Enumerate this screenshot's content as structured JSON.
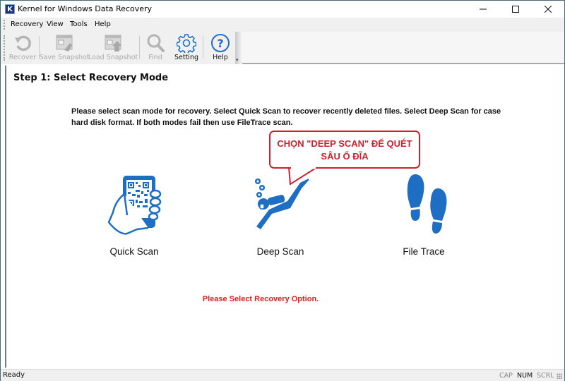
{
  "window": {
    "title": "Kernel for Windows Data Recovery",
    "app_icon_letter": "K",
    "controls": {
      "minimize": "minimize-icon",
      "maximize": "maximize-icon",
      "close": "close-icon"
    }
  },
  "menu": {
    "items": [
      {
        "label": "Recovery"
      },
      {
        "label": "View"
      },
      {
        "label": "Tools"
      },
      {
        "label": "Help"
      }
    ]
  },
  "toolbar": {
    "buttons": [
      {
        "label": "Recover",
        "icon": "recover-icon",
        "enabled": false
      },
      {
        "label": "Save Snapshot",
        "icon": "save-snapshot-icon",
        "enabled": false
      },
      {
        "label": "Load Snapshot",
        "icon": "load-snapshot-icon",
        "enabled": false
      },
      {
        "label": "Find",
        "icon": "search-icon",
        "enabled": false
      },
      {
        "label": "Setting",
        "icon": "gear-icon",
        "enabled": true
      },
      {
        "label": "Help",
        "icon": "help-icon",
        "enabled": true
      }
    ],
    "overflow": "▾"
  },
  "brand": {
    "name": "Kernel",
    "subtitle": "for Windows Data Recovery",
    "color": "#1f4fa0"
  },
  "main": {
    "step_title": "Step 1: Select Recovery Mode",
    "instructions": "Please select scan mode for recovery. Select Quick Scan to recover recently deleted files. Select Deep Scan for case hard disk format. If both modes fail then use FileTrace scan.",
    "callout": {
      "line1": "CHỌN \"DEEP SCAN\" ĐỂ QUÉT",
      "line2": "SÂU Ổ ĐĨA",
      "color": "#d02030"
    },
    "modes": [
      {
        "label": "Quick Scan",
        "icon": "phone-qr-icon"
      },
      {
        "label": "Deep Scan",
        "icon": "scuba-diver-icon"
      },
      {
        "label": "File Trace",
        "icon": "footprints-icon"
      }
    ],
    "icon_color": "#1e6fc4",
    "status_message": "Please Select Recovery Option.",
    "status_color": "#e02020"
  },
  "statusbar": {
    "text": "Ready",
    "indicators": [
      {
        "label": "CAP",
        "active": false
      },
      {
        "label": "NUM",
        "active": true
      },
      {
        "label": "SCRL",
        "active": false
      }
    ]
  }
}
